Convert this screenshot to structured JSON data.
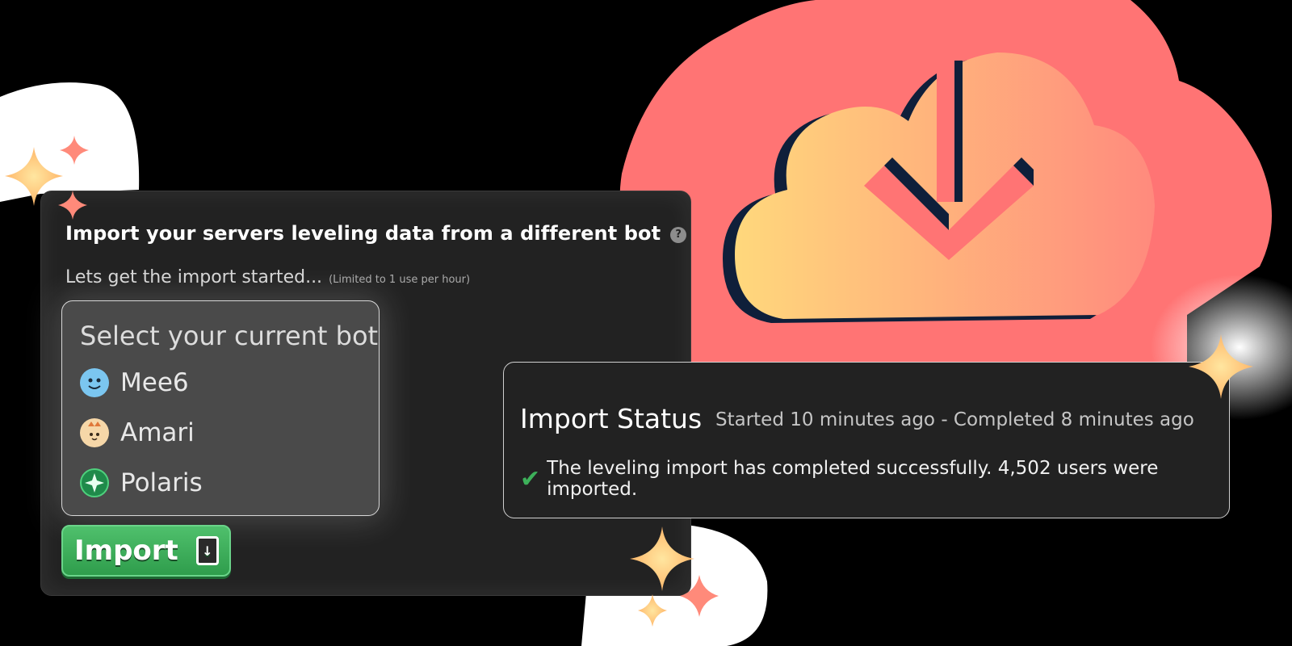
{
  "colors": {
    "accent_red": "#ff7474",
    "cloud_from": "#ffd47a",
    "cloud_to": "#ff8a7a",
    "button_green": "#3aa957",
    "panel_bg": "#222222"
  },
  "importer": {
    "title": "Import your servers leveling data from a different bot",
    "help_icon": "?",
    "subtitle": "Lets get the import started...",
    "subtitle_note": "(Limited to 1 use per hour)",
    "select_title": "Select your current bot",
    "bots": [
      {
        "name": "Mee6",
        "icon": "mee6-icon"
      },
      {
        "name": "Amari",
        "icon": "amari-icon"
      },
      {
        "name": "Polaris",
        "icon": "polaris-icon"
      }
    ],
    "import_button": "Import"
  },
  "status": {
    "title": "Import Status",
    "time": "Started 10 minutes ago - Completed 8 minutes ago",
    "message": "The leveling import has completed successfully. 4,502 users were imported."
  },
  "icons": [
    "cloud-download-icon",
    "check-icon",
    "sparkle-icon"
  ]
}
